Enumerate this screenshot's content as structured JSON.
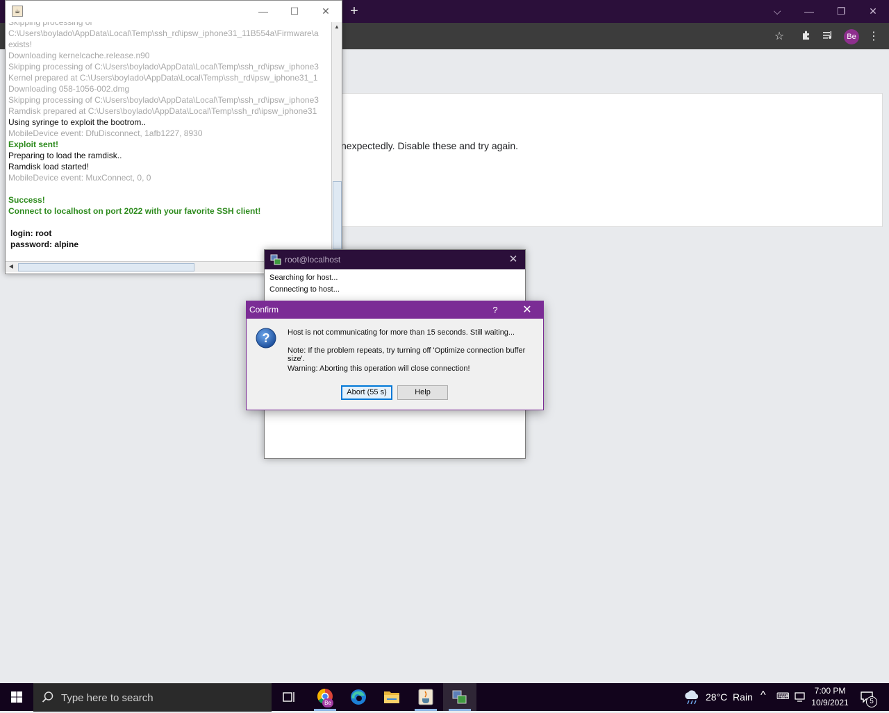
{
  "browser": {
    "avatar_initials": "Be",
    "card_text": "nexpectedly. Disable these and try again."
  },
  "java_console": {
    "lines": [
      {
        "text": "Skipping processing of",
        "style": "gray"
      },
      {
        "text": "C:\\Users\\boylado\\AppData\\Local\\Temp\\ssh_rd\\ipsw_iphone31_11B554a\\Firmware\\a",
        "style": "gray"
      },
      {
        "text": "exists!",
        "style": "gray"
      },
      {
        "text": "Downloading kernelcache.release.n90",
        "style": "gray"
      },
      {
        "text": "Skipping processing of C:\\Users\\boylado\\AppData\\Local\\Temp\\ssh_rd\\ipsw_iphone3",
        "style": "gray"
      },
      {
        "text": "Kernel prepared at C:\\Users\\boylado\\AppData\\Local\\Temp\\ssh_rd\\ipsw_iphone31_1",
        "style": "gray"
      },
      {
        "text": "Downloading 058-1056-002.dmg",
        "style": "gray"
      },
      {
        "text": "Skipping processing of C:\\Users\\boylado\\AppData\\Local\\Temp\\ssh_rd\\ipsw_iphone3",
        "style": "gray"
      },
      {
        "text": "Ramdisk prepared at C:\\Users\\boylado\\AppData\\Local\\Temp\\ssh_rd\\ipsw_iphone31",
        "style": "gray"
      },
      {
        "text": "Using syringe to exploit the bootrom..",
        "style": "black"
      },
      {
        "text": "MobileDevice event: DfuDisconnect, 1afb1227, 8930",
        "style": "gray"
      },
      {
        "text": "Exploit sent!",
        "style": "green"
      },
      {
        "text": "Preparing to load the ramdisk..",
        "style": "black"
      },
      {
        "text": "Ramdisk load started!",
        "style": "black"
      },
      {
        "text": "MobileDevice event: MuxConnect, 0, 0",
        "style": "gray"
      },
      {
        "text": "",
        "style": "black"
      },
      {
        "text": "Success!",
        "style": "green"
      },
      {
        "text": "Connect to localhost on port 2022 with your favorite SSH client!",
        "style": "green"
      },
      {
        "text": "",
        "style": "black"
      },
      {
        "text": "login: root",
        "style": "bold"
      },
      {
        "text": "password: alpine",
        "style": "bold"
      }
    ]
  },
  "ssh_window": {
    "title": "root@localhost",
    "status": [
      "Searching for host...",
      "Connecting to host..."
    ]
  },
  "confirm_dialog": {
    "title": "Confirm",
    "help_glyph": "?",
    "message_1": "Host is not communicating for more than 15 seconds. Still waiting...",
    "message_2": "Note: If the problem repeats, try turning off 'Optimize connection buffer size'.",
    "message_3": "Warning: Aborting this operation will close connection!",
    "abort_label": "Abort (55 s)",
    "help_label": "Help"
  },
  "taskbar": {
    "search_placeholder": "Type here to search",
    "weather": "28°C  Rain",
    "time": "7:00 PM",
    "date": "10/9/2021",
    "notification_count": "5",
    "chrome_badge": "Be"
  },
  "colors": {
    "chrome_titlebar": "#2b0f3a",
    "confirm_accent": "#7b2c95",
    "success_green": "#2e8b1e"
  }
}
